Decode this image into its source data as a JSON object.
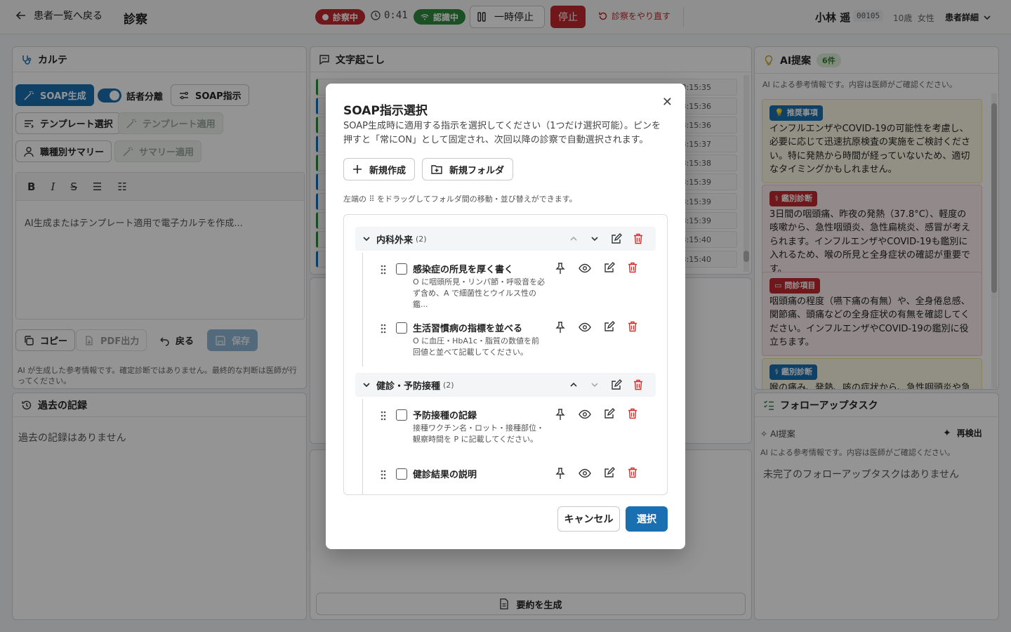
{
  "header": {
    "back_label": "患者一覧へ戻る",
    "title": "診察",
    "recording_label": "診察中",
    "timer": "0:41",
    "recognition_label": "認識中",
    "pause_label": "一時停止",
    "stop_label": "停止",
    "redo_label": "診察をやり直す",
    "patient_name": "小林 遥",
    "patient_id": "00105",
    "patient_age": "10歳",
    "patient_sex": "女性",
    "patient_detail_label": "患者詳細"
  },
  "karte": {
    "title": "カルテ",
    "soap_generate": "SOAP生成",
    "speaker_sep": "話者分離",
    "soap_instruction": "SOAP指示",
    "template_select": "テンプレート選択",
    "template_apply": "テンプレート適用",
    "role_summary": "職種別サマリー",
    "summary_apply": "サマリー適用",
    "editor_placeholder": "AI生成またはテンプレート適用で電子カルテを作成...",
    "copy": "コピー",
    "pdf": "PDF出力",
    "back": "戻る",
    "save": "保存",
    "disclaimer": "AI が生成した参考情報です。確定診断ではありません。最終的な判断は医師が行ってください。"
  },
  "past_records": {
    "title": "過去の記録",
    "empty": "過去の記録はありません"
  },
  "transcript": {
    "title": "文字起こし",
    "times": [
      "23:15:35",
      "23:15:36",
      "23:15:36",
      "23:15:37",
      "23:15:38",
      "23:15:39",
      "23:15:39",
      "23:15:39",
      "23:15:40",
      "23:15:40"
    ],
    "generate_summary": "要約を生成"
  },
  "ai": {
    "title": "AI提案",
    "count": "6件",
    "note": "AI による参考情報です。内容は医師がご確認ください。",
    "cards": [
      {
        "badge": "推奨事項",
        "color": "#1a6fb0",
        "bg": "#fbf8e3",
        "border": "#efe3a0",
        "text": "インフルエンザやCOVID-19の可能性を考慮し、必要に応じて迅速抗原検査の実施をご検討ください。特に発熱から時間が経っていないため、適切なタイミングかもしれません。"
      },
      {
        "badge": "鑑別診断",
        "color": "#c0282e",
        "bg": "#fbeeee",
        "border": "#efc8c8",
        "text": "3日間の咽頭痛、昨夜の発熱（37.8°C）、軽度の咳嗽から、急性咽頭炎、急性扁桃炎、感冒が考えられます。インフルエンザやCOVID-19も鑑別に入れるため、喉の所見と全身症状の確認が重要です。"
      },
      {
        "badge": "問診項目",
        "color": "#c0282e",
        "bg": "#fbeeee",
        "border": "#efc8c8",
        "text": "咽頭痛の程度（嚥下痛の有無）や、全身倦怠感、関節痛、頭痛などの全身症状の有無を確認してください。インフルエンザやCOVID-19の鑑別に役立ちます。"
      },
      {
        "badge": "鑑別診断",
        "color": "#1a6fb0",
        "bg": "#fbf8e3",
        "border": "#efe3a0",
        "text": "喉の痛み、発熱、咳の症状から、急性咽頭炎や急性"
      }
    ]
  },
  "followup": {
    "title": "フォローアップタスク",
    "ai_label": "AI提案",
    "redetect": "再検出",
    "note": "AI による参考情報です。内容は医師がご確認ください。",
    "empty": "未完了のフォローアップタスクはありません"
  },
  "modal": {
    "title": "SOAP指示選択",
    "description": "SOAP生成時に適用する指示を選択してください（1つだけ選択可能）。ピンを押すと「常にON」として固定され、次回以降の診察で自動選択されます。",
    "new_create": "新規作成",
    "new_folder": "新規フォルダ",
    "hint": "左端の ⠿ をドラッグしてフォルダ間の移動・並び替えができます。",
    "folders": [
      {
        "name": "内科外来",
        "count": "(2)",
        "items": [
          {
            "title": "感染症の所見を厚く書く",
            "desc": "O に咽頭所見・リンパ節・呼吸音を必ず含め、A で細菌性とウイルス性の鑑..."
          },
          {
            "title": "生活習慣病の指標を並べる",
            "desc": "O に血圧・HbA1c・脂質の数値を前回値と並べて記載してください。"
          }
        ]
      },
      {
        "name": "健診・予防接種",
        "count": "(2)",
        "items": [
          {
            "title": "予防接種の記録",
            "desc": "接種ワクチン名・ロット・接種部位・観察時間を P に記載してください。"
          },
          {
            "title": "健診結果の説明",
            "desc": ""
          }
        ]
      }
    ],
    "cancel": "キャンセル",
    "select": "選択"
  }
}
